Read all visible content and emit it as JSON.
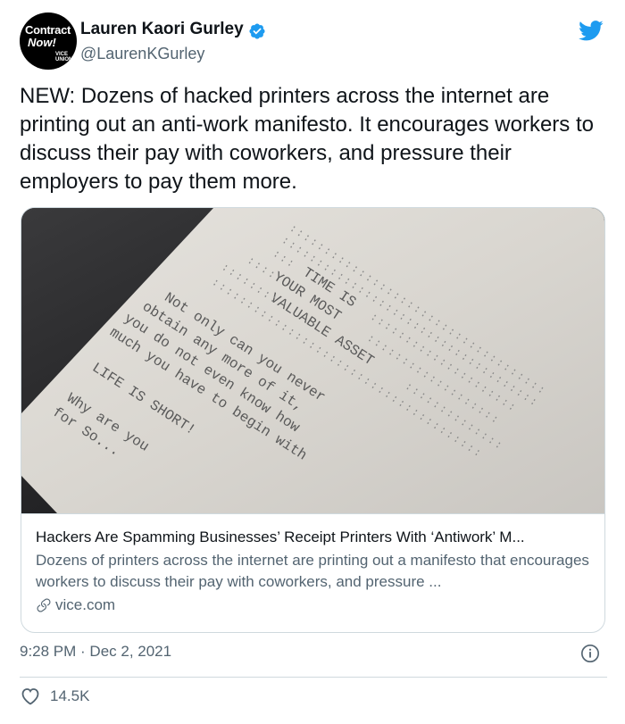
{
  "author": {
    "avatar_text": {
      "line1": "Contract",
      "line2": "Now!",
      "line3": "VICE UNION"
    },
    "name": "Lauren Kaori Gurley",
    "handle": "@LaurenKGurley",
    "verified": true
  },
  "tweet": {
    "text": "NEW: Dozens of hacked printers across the internet are printing out an anti-work manifesto. It encourages workers to discuss their pay with coworkers, and pressure their employers to pay them more.",
    "timestamp": "9:28 PM · Dec 2, 2021",
    "likes": "14.5K"
  },
  "card": {
    "image": {
      "description_lines": [
        "TIME IS",
        "YOUR MOST",
        "VALUABLE ASSET",
        "Not only can you never",
        "obtain any more of it,",
        "you do not even know how",
        "much you have to begin with",
        "LIFE IS SHORT!",
        "Why are you",
        "for So..."
      ]
    },
    "title": "Hackers Are Spamming Businesses’ Receipt Printers With ‘Antiwork’ M...",
    "description": "Dozens of printers across the internet are printing out a manifesto that encourages workers to discuss their pay with coworkers, and pressure ...",
    "domain": "vice.com"
  },
  "colors": {
    "twitter_blue": "#1d9bf0",
    "text": "#0f1419",
    "secondary": "#536471",
    "border": "#cfd9de"
  }
}
